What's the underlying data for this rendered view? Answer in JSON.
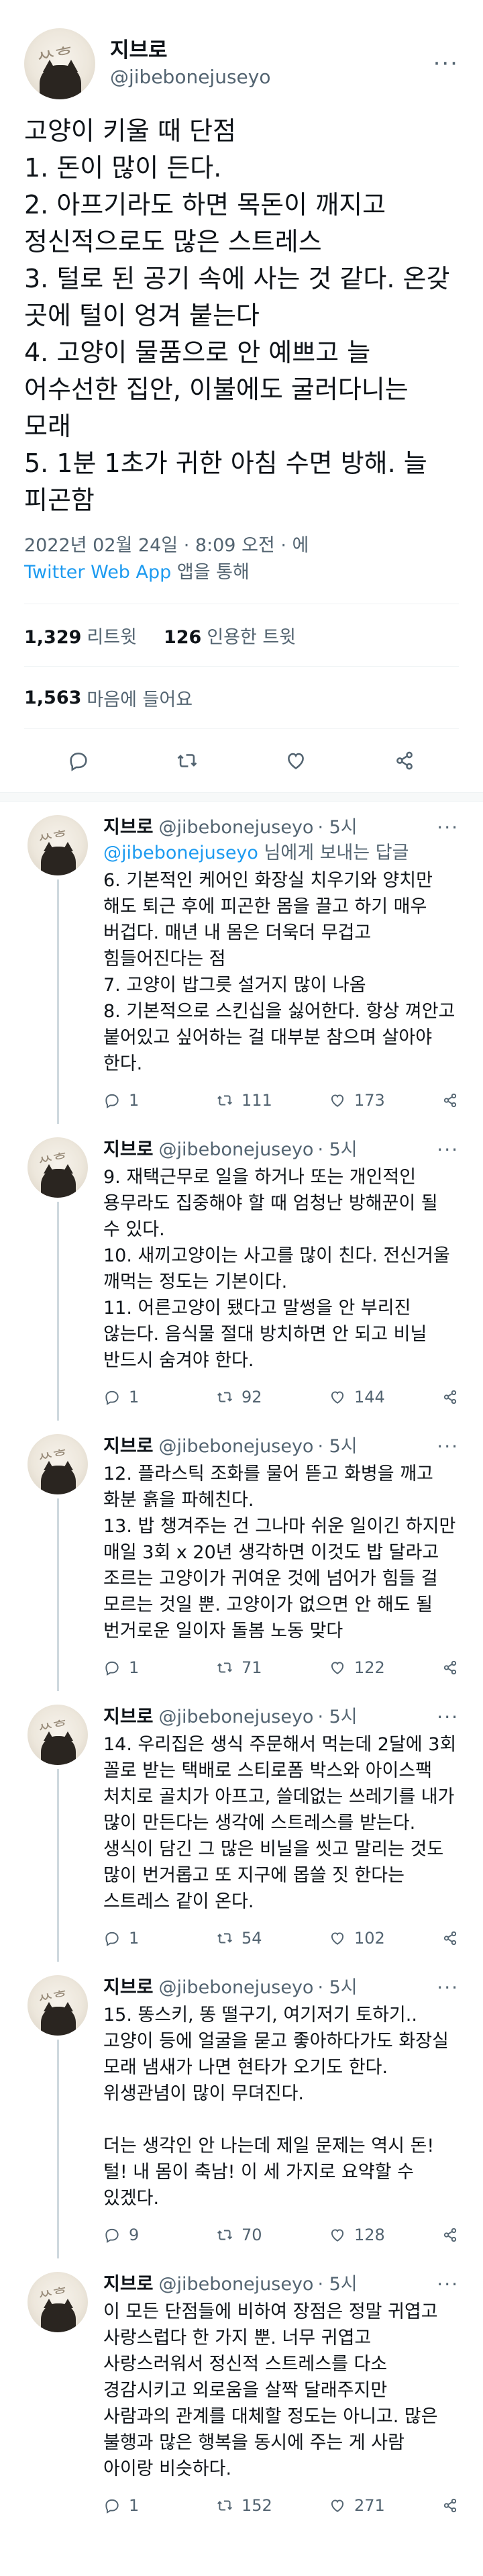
{
  "main_tweet": {
    "display_name": "지브로",
    "handle": "@jibebonejuseyo",
    "text": "고양이 키울 때 단점\n1. 돈이 많이 든다.\n2. 아프기라도 하면 목돈이 깨지고 정신적으로도 많은 스트레스\n3. 털로 된 공기 속에 사는 것 같다. 온갖 곳에 털이 엉겨 붙는다\n4. 고양이 물품으로 안 예쁘고 늘 어수선한 집안, 이불에도 굴러다니는 모래\n5. 1분 1초가 귀한 아침 수면 방해. 늘 피곤함",
    "timestamp": "2022년 02월 24일 · 8:09 오전 · 에",
    "source": "Twitter Web App",
    "source_suffix": " 앱을 통해",
    "retweets_count": "1,329",
    "retweets_label": "리트윗",
    "quotes_count": "126",
    "quotes_label": "인용한 트윗",
    "likes_count": "1,563",
    "likes_label": "마음에 들어요"
  },
  "replies": [
    {
      "name": "지브로",
      "handle": "@jibebonejuseyo",
      "time": "· 5시",
      "replying_to": "@jibebonejuseyo",
      "replying_suffix": " 님에게 보내는 답글",
      "text": "6. 기본적인 케어인 화장실 치우기와 양치만 해도 퇴근 후에 피곤한 몸을 끌고 하기 매우 버겁다. 매년 내 몸은 더욱더 무겁고 힘들어진다는 점\n7. 고양이 밥그릇 설거지 많이 나옴\n8. 기본적으로 스킨십을 싫어한다. 항상 껴안고 붙어있고 싶어하는 걸 대부분 참으며 살아야 한다.",
      "reply_count": "1",
      "retweet_count": "111",
      "like_count": "173"
    },
    {
      "name": "지브로",
      "handle": "@jibebonejuseyo",
      "time": "· 5시",
      "text": "9. 재택근무로 일을 하거나 또는 개인적인 용무라도 집중해야 할 때 엄청난 방해꾼이 될 수 있다.\n10. 새끼고양이는 사고를 많이 친다. 전신거울 깨먹는 정도는 기본이다.\n11. 어른고양이 됐다고 말썽을 안 부리진 않는다. 음식물 절대 방치하면 안 되고 비닐 반드시 숨겨야 한다.",
      "reply_count": "1",
      "retweet_count": "92",
      "like_count": "144"
    },
    {
      "name": "지브로",
      "handle": "@jibebonejuseyo",
      "time": "· 5시",
      "text": "12. 플라스틱 조화를 물어 뜯고 화병을 깨고 화분 흙을 파헤친다.\n13. 밥 챙겨주는 건 그나마 쉬운 일이긴 하지만 매일 3회 x 20년 생각하면 이것도 밥 달라고 조르는 고양이가 귀여운 것에 넘어가 힘들 걸 모르는 것일 뿐. 고양이가 없으면 안 해도 될 번거로운 일이자 돌봄 노동 맞다",
      "reply_count": "1",
      "retweet_count": "71",
      "like_count": "122"
    },
    {
      "name": "지브로",
      "handle": "@jibebonejuseyo",
      "time": "· 5시",
      "text": "14. 우리집은 생식 주문해서 먹는데 2달에 3회 꼴로 받는 택배로 스티로폼 박스와 아이스팩 처치로 골치가 아프고, 쓸데없는 쓰레기를 내가 많이 만든다는 생각에 스트레스를 받는다. 생식이 담긴 그 많은 비닐을 씻고 말리는 것도 많이 번거롭고 또 지구에 몹쓸 짓 한다는 스트레스 같이 온다.",
      "reply_count": "1",
      "retweet_count": "54",
      "like_count": "102"
    },
    {
      "name": "지브로",
      "handle": "@jibebonejuseyo",
      "time": "· 5시",
      "text": "15. 똥스키, 똥 떨구기, 여기저기 토하기..고양이 등에 얼굴을 묻고 좋아하다가도 화장실 모래 냄새가 나면 현타가 오기도 한다. 위생관념이 많이 무뎌진다.\n\n더는 생각인 안 나는데 제일 문제는 역시 돈! 털! 내 몸이 축남! 이 세 가지로 요약할 수 있겠다.",
      "reply_count": "9",
      "retweet_count": "70",
      "like_count": "128"
    },
    {
      "name": "지브로",
      "handle": "@jibebonejuseyo",
      "time": "· 5시",
      "text": "이 모든 단점들에 비하여 장점은 정말 귀엽고 사랑스럽다 한 가지 뿐. 너무 귀엽고 사랑스러워서 정신적 스트레스를 다소 경감시키고 외로움을 살짝 달래주지만 사람과의 관계를 대체할 정도는 아니고. 많은 불행과 많은 행복을 동시에 주는 게 사람 아이랑 비슷하다.",
      "reply_count": "1",
      "retweet_count": "152",
      "like_count": "271"
    }
  ],
  "icons": {
    "more": "more-horizontal-icon",
    "reply": "reply-bubble-icon",
    "retweet": "retweet-icon",
    "like": "heart-icon",
    "share": "share-icon"
  },
  "colors": {
    "link": "#1d9bf0",
    "secondary_text": "#536471",
    "primary_text": "#0f1419"
  }
}
